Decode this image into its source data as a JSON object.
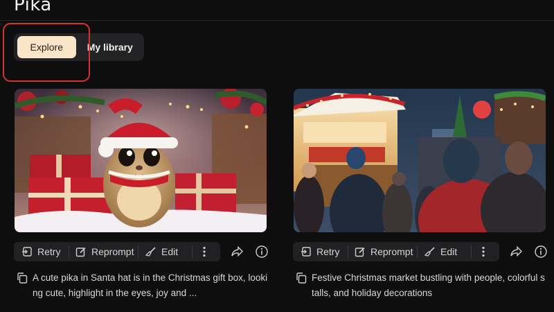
{
  "app": {
    "title": "Pika"
  },
  "tabs": [
    {
      "label": "Explore",
      "active": true
    },
    {
      "label": "My library",
      "active": false
    }
  ],
  "accent": {
    "active_tab_bg": "#fbe5c9",
    "highlight_ring": "#d8322f"
  },
  "cards": [
    {
      "image": "pika-santa-hat-christmas-gifts",
      "actions": {
        "retry": "Retry",
        "reprompt": "Reprompt",
        "edit": "Edit"
      },
      "description": "A cute pika in Santa hat is in the Christmas gift box, looking cute, highlight in the eyes, joy and ..."
    },
    {
      "image": "festive-christmas-market-crowd",
      "actions": {
        "retry": "Retry",
        "reprompt": "Reprompt",
        "edit": "Edit"
      },
      "description": "Festive Christmas market bustling with people, colorful stalls, and holiday decorations"
    }
  ],
  "icons": [
    "retry-icon",
    "reprompt-icon",
    "edit-brush-icon",
    "more-vertical-icon",
    "share-icon",
    "info-icon",
    "copy-icon"
  ]
}
